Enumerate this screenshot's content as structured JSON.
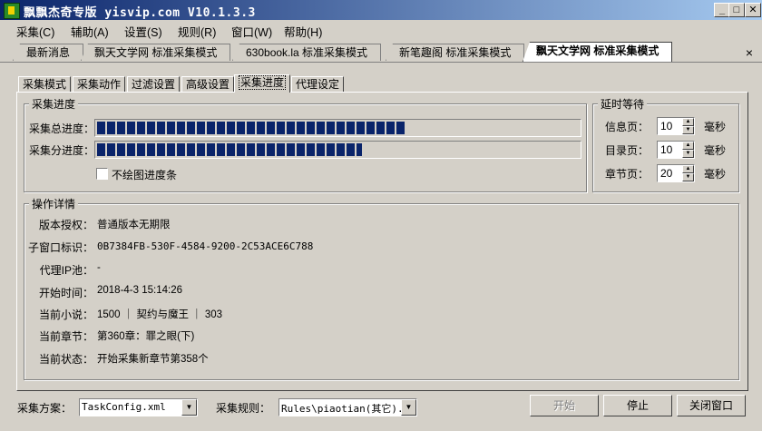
{
  "window": {
    "title": "飘飘杰奇专版 yisvip.com V10.1.3.3",
    "minimize": "_",
    "maximize": "□",
    "close": "✕"
  },
  "menu": [
    "采集(C)",
    "辅助(A)",
    "设置(S)",
    "规则(R)",
    "窗口(W)",
    "帮助(H)"
  ],
  "doc_tabs": [
    {
      "label": "最新消息"
    },
    {
      "label": "飘天文学网 标准采集模式"
    },
    {
      "label": "630book.la 标准采集模式"
    },
    {
      "label": "新笔趣阁 标准采集模式"
    },
    {
      "label": "飘天文学网 标准采集模式",
      "active": true
    }
  ],
  "doc_tab_close": "×",
  "inner_tabs": [
    {
      "label": "采集模式"
    },
    {
      "label": "采集动作"
    },
    {
      "label": "过滤设置"
    },
    {
      "label": "高级设置"
    },
    {
      "label": "采集进度",
      "active": true
    },
    {
      "label": "代理设定"
    }
  ],
  "progress_group": {
    "title": "采集进度",
    "total_label": "采集总进度：",
    "total_value": 0.64,
    "sub_label": "采集分进度：",
    "sub_value": 0.55,
    "no_draw_label": "不绘图进度条",
    "no_draw_checked": false
  },
  "delay_group": {
    "title": "延时等待",
    "rows": [
      {
        "label": "信息页：",
        "value": "10",
        "unit": "毫秒"
      },
      {
        "label": "目录页：",
        "value": "10",
        "unit": "毫秒"
      },
      {
        "label": "章节页：",
        "value": "20",
        "unit": "毫秒"
      }
    ]
  },
  "details_group": {
    "title": "操作详情",
    "rows": [
      {
        "label": "版本授权：",
        "value": "普通版本无期限"
      },
      {
        "label": "子窗口标识：",
        "value": "0B7384FB-530F-4584-9200-2C53ACE6C788"
      },
      {
        "label": "代理IP池：",
        "value": "-"
      },
      {
        "label": "开始时间：",
        "value": "2018-4-3 15:14:26"
      },
      {
        "label": "当前小说：",
        "value": "1500 ｜ 契约与魔王 ｜ 303"
      },
      {
        "label": "当前章节：",
        "value": "第360章：罪之眼(下)"
      },
      {
        "label": "当前状态：",
        "value": "开始采集新章节第358个"
      }
    ]
  },
  "bottom": {
    "scheme_label": "采集方案：",
    "scheme_value": "TaskConfig.xml",
    "rule_label": "采集规则：",
    "rule_value": "Rules\\piaotian(其它).x",
    "start_button": "开始",
    "stop_button": "停止",
    "close_button": "关闭窗口"
  }
}
